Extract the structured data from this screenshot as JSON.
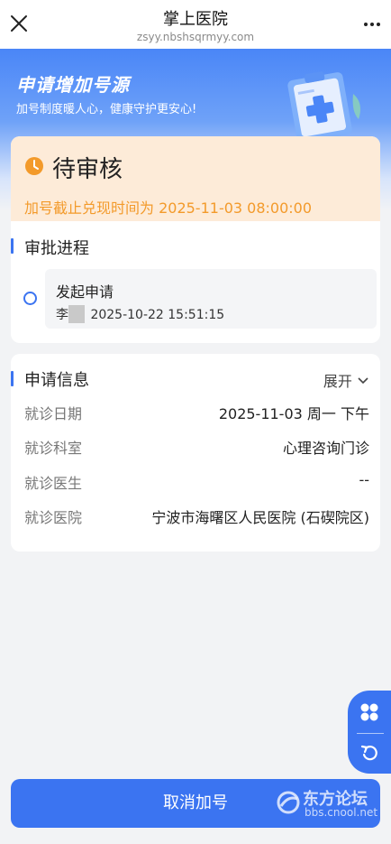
{
  "topbar": {
    "title": "掌上医院",
    "url": "zsyy.nbshsqrmyy.com"
  },
  "banner": {
    "title": "申请增加号源",
    "subtitle": "加号制度暖人心，健康守护更安心!"
  },
  "status": {
    "label": "待审核",
    "deadline": "加号截止兑现时间为 2025-11-03 08:00:00"
  },
  "approval": {
    "section_title": "审批进程",
    "steps": [
      {
        "name": "发起申请",
        "applicant": "李",
        "time": "2025-10-22 15:51:15"
      }
    ]
  },
  "info": {
    "section_title": "申请信息",
    "expand_label": "展开",
    "rows": [
      {
        "key": "就诊日期",
        "value": "2025-11-03 周一 下午"
      },
      {
        "key": "就诊科室",
        "value": "心理咨询门诊"
      },
      {
        "key": "就诊医生",
        "value": "--"
      },
      {
        "key": "就诊医院",
        "value": "宁波市海曙区人民医院 (石碶院区)"
      }
    ]
  },
  "actions": {
    "cancel_label": "取消加号"
  },
  "watermark": {
    "main": "东方论坛",
    "sub": "bbs.cnool.net"
  },
  "colors": {
    "accent": "#3b74f1",
    "status_bg": "#fdebd8",
    "status_fg": "#f39a2a"
  }
}
